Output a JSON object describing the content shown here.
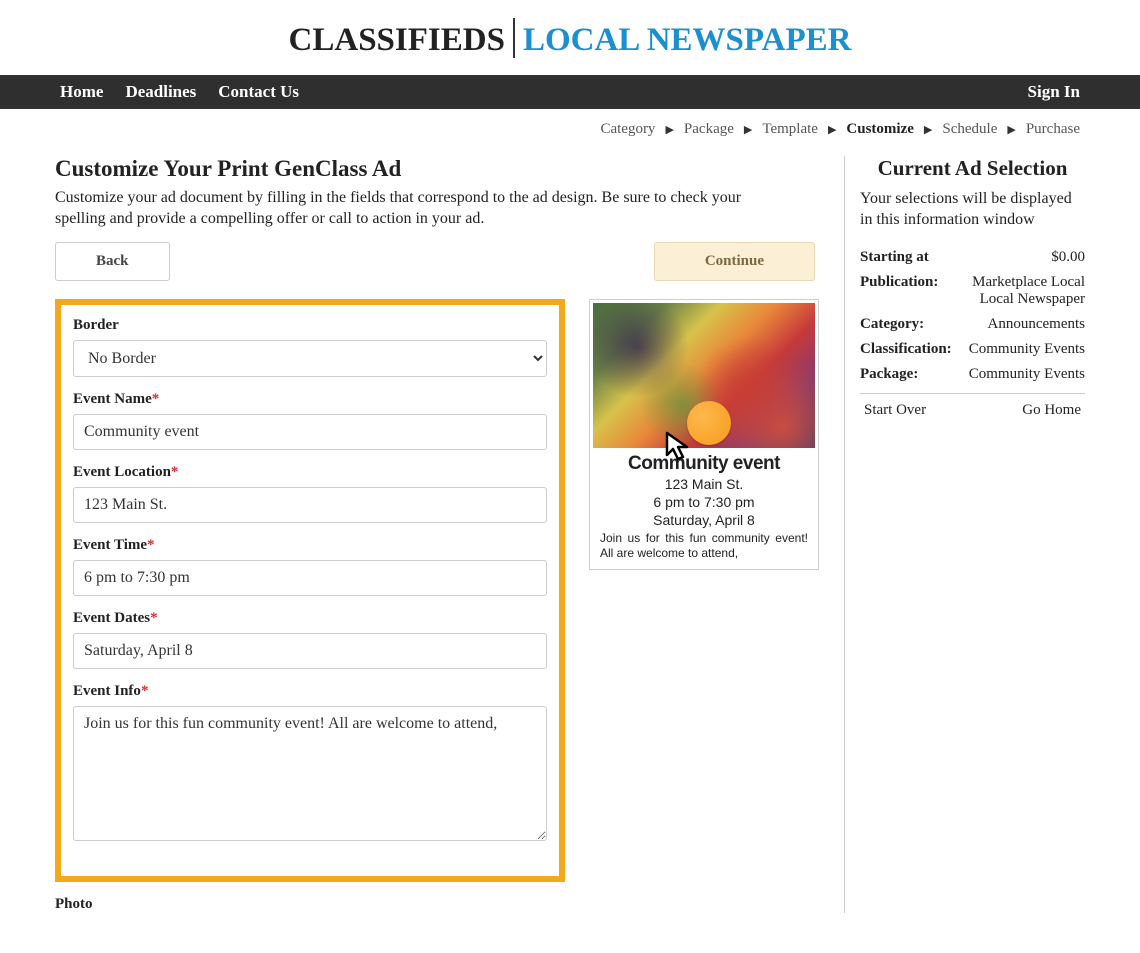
{
  "header": {
    "title": "CLASSIFIEDS",
    "subtitle": "LOCAL NEWSPAPER"
  },
  "nav": {
    "home": "Home",
    "deadlines": "Deadlines",
    "contact": "Contact Us",
    "signin": "Sign In"
  },
  "breadcrumb": {
    "steps": [
      "Category",
      "Package",
      "Template",
      "Customize",
      "Schedule",
      "Purchase"
    ],
    "active_index": 3
  },
  "main": {
    "title": "Customize Your Print GenClass Ad",
    "description": "Customize your ad document by filling in the fields that correspond to the ad design. Be sure to check your spelling and provide a compelling offer or call to action in your ad.",
    "back_label": "Back",
    "continue_label": "Continue"
  },
  "form": {
    "border_label": "Border",
    "border_value": "No Border",
    "event_name_label": "Event Name",
    "event_name_value": "Community event",
    "event_location_label": "Event Location",
    "event_location_value": "123 Main St.",
    "event_time_label": "Event Time",
    "event_time_value": "6 pm to 7:30 pm",
    "event_dates_label": "Event Dates",
    "event_dates_value": "Saturday, April 8",
    "event_info_label": "Event Info",
    "event_info_value": "Join us for this fun community event! All are welcome to attend,",
    "photo_label": "Photo"
  },
  "preview": {
    "event_name": "Community event",
    "location": "123 Main St.",
    "time": "6 pm to 7:30 pm",
    "dates": "Saturday, April 8",
    "info": "Join us for this fun community event! All are welcome to attend,"
  },
  "sidebar": {
    "title": "Current Ad Selection",
    "description": "Your selections will be displayed in this information window",
    "rows": [
      {
        "label": "Starting at",
        "value": "$0.00"
      },
      {
        "label": "Publication:",
        "value": "Marketplace Local Local Newspaper"
      },
      {
        "label": "Category:",
        "value": "Announcements"
      },
      {
        "label": "Classification:",
        "value": "Community Events"
      },
      {
        "label": "Package:",
        "value": "Community Events"
      }
    ],
    "start_over": "Start Over",
    "go_home": "Go Home"
  }
}
